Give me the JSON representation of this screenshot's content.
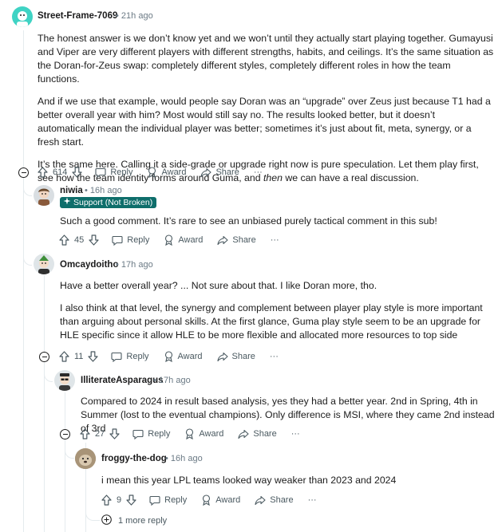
{
  "comments": [
    {
      "username": "Street-Frame-7069",
      "time": "21h ago",
      "paragraphs": [
        "The honest answer is we don’t know yet and we won’t until they actually start playing together. Gumayusi and Viper are very different players with different strengths, habits, and ceilings. It’s the same situation as the Doran-for-Zeus swap: completely different styles, completely different roles in how the team functions.",
        "And if we use that example, would people say Doran was an “upgrade” over Zeus just because T1 had a better overall year with him? Most would still say no. The results looked better, but it doesn’t automatically mean the individual player was better; sometimes it’s just about fit, meta, synergy, or a fresh start."
      ],
      "p3_before": "It’s the same here. Calling it a side-grade or upgrade right now is pure speculation. Let them play first, see how the team identity forms around Guma, and ",
      "p3_em": "then",
      "p3_after": " we can have a real discussion.",
      "score": "614"
    },
    {
      "username": "niwia",
      "time": "16h ago",
      "flair": "Support (Not Broken)",
      "text": "Such a good comment. It’s rare to see an unbiased purely tactical comment in this sub!",
      "score": "45"
    },
    {
      "username": "Omcaydoitho",
      "time": "17h ago",
      "paragraphs": [
        "Have a better overall year? ... Not sure about that. I like Doran more, tho.",
        "I also think at that level, the synergy and complement between player play style is more important than arguing about personal skills. At the first glance, Guma play style seem to be an upgrade for HLE specific since it allow HLE to be more flexible and allocated more resources to top side"
      ],
      "score": "11"
    },
    {
      "username": "IlliterateAsparagus",
      "time": "17h ago",
      "text": "Compared to 2024 in result based analysis, yes they had a better year. 2nd in Spring, 4th in Summer (lost to the eventual champions). Only difference is MSI, where they came 2nd instead of 3rd",
      "score": "27"
    },
    {
      "username": "froggy-the-dog",
      "time": "16h ago",
      "text": "i mean this year LPL teams looked way weaker than 2023 and 2024",
      "score": "9"
    }
  ],
  "actions": {
    "reply": "Reply",
    "award": "Award",
    "share": "Share",
    "more": "···"
  },
  "separator": "•",
  "more_replies": "1 more reply",
  "colors": {
    "flair_bg": "#0e6e6b",
    "meta": "#6b7a85",
    "thread_line": "#e5ebee"
  }
}
